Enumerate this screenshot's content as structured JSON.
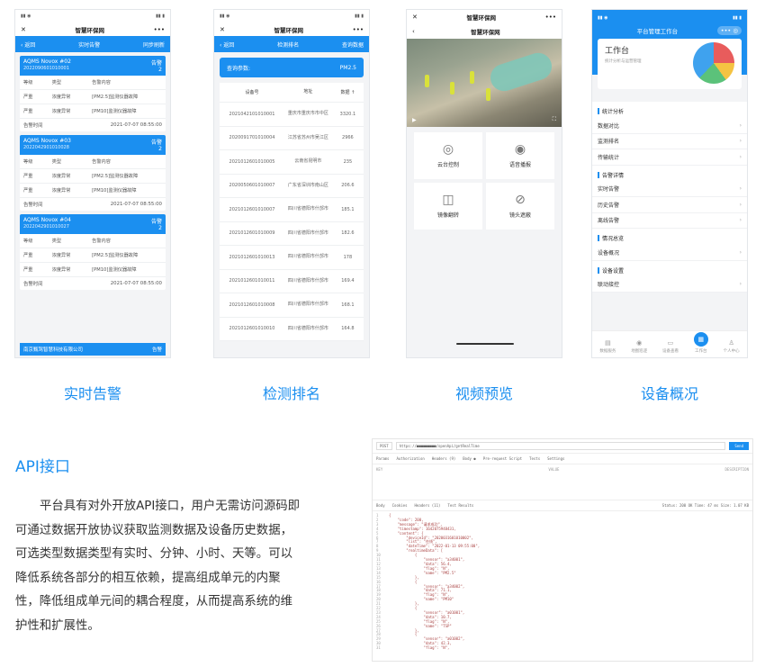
{
  "screens": {
    "alarm": {
      "window_title": "智慧环保网",
      "back": "‹ 返回",
      "title": "实时告警",
      "sync": "同步刷新",
      "cards": [
        {
          "device": "AQMS Novox #02",
          "code": "2022090601010001",
          "tag": "告警",
          "count": "2",
          "rows": [
            [
              "等级",
              "类型",
              "告警内容"
            ],
            [
              "严重",
              "浓度异常",
              "[PM2.5]监测仪器故障"
            ],
            [
              "严重",
              "浓度异常",
              "[PM10]监测仪器故障"
            ]
          ],
          "time_label": "告警时间",
          "time": "2021-07-07 08:55:00"
        },
        {
          "device": "AQMS Novox #03",
          "code": "2022042901010028",
          "tag": "告警",
          "count": "2",
          "rows": [
            [
              "等级",
              "类型",
              "告警内容"
            ],
            [
              "严重",
              "浓度异常",
              "[PM2.5]监测仪器故障"
            ],
            [
              "严重",
              "浓度异常",
              "[PM10]监测仪器故障"
            ]
          ],
          "time_label": "告警时间",
          "time": "2021-07-07 08:55:00"
        },
        {
          "device": "AQMS Novox #04",
          "code": "2022042901010027",
          "tag": "告警",
          "count": "2",
          "rows": [
            [
              "等级",
              "类型",
              "告警内容"
            ],
            [
              "严重",
              "浓度异常",
              "[PM2.5]监测仪器故障"
            ],
            [
              "严重",
              "浓度异常",
              "[PM10]监测仪器故障"
            ]
          ],
          "time_label": "告警时间",
          "time": "2021-07-07 08:55:00"
        }
      ],
      "footer": "南京甄驾智慧科技有限公司",
      "footer_tag": "告警"
    },
    "ranking": {
      "window_title": "智慧环保网",
      "back": "‹ 返回",
      "title": "检测排名",
      "query": "查询数据",
      "param_label": "查询参数:",
      "param_value": "PM2.5",
      "headers": [
        "设备号",
        "地址",
        "数据 ↑"
      ],
      "rows": [
        [
          "2021042101010001",
          "重庆市重庆市市中区",
          "3320.1"
        ],
        [
          "2020091701010004",
          "江苏省苏州市吴江区",
          "2966"
        ],
        [
          "2021012601010005",
          "云南省昆明市",
          "235"
        ],
        [
          "2020050601010007",
          "广东省深圳市南山区",
          "206.6"
        ],
        [
          "2021012601010007",
          "四川省德阳市什邡市",
          "185.1"
        ],
        [
          "2021012601010009",
          "四川省德阳市什邡市",
          "182.6"
        ],
        [
          "2021012601010013",
          "四川省德阳市什邡市",
          "178"
        ],
        [
          "2021012601010011",
          "四川省德阳市什邡市",
          "169.4"
        ],
        [
          "2021012601010008",
          "四川省德阳市什邡市",
          "168.1"
        ],
        [
          "2021012601010010",
          "四川省德阳市什邡市",
          "164.8"
        ]
      ]
    },
    "video": {
      "window_title": "智慧环保网",
      "sub_title": "智慧环保网",
      "controls": [
        "云台控制",
        "语音播报",
        "镜像翻转",
        "镜头遮蔽"
      ],
      "control_icons": [
        "ptz-icon",
        "speaker-icon",
        "mirror-icon",
        "eye-hidden-icon"
      ]
    },
    "overview": {
      "title": "平台管理工作台",
      "card_title": "工作台",
      "card_sub": "统计分析与运营管理",
      "sections": [
        {
          "title": "统计分析",
          "items": [
            "数据对比",
            "监测排名",
            "传输统计"
          ]
        },
        {
          "title": "告警详情",
          "items": [
            "实时告警",
            "历史告警",
            "离线告警"
          ]
        },
        {
          "title": "情况总览",
          "items": [
            "设备概况"
          ]
        },
        {
          "title": "设备设置",
          "items": [
            "联动接控"
          ]
        }
      ],
      "tabs": [
        "数据服务",
        "地图巡逻",
        "设备查看",
        "工作台",
        "个人中心"
      ]
    }
  },
  "captions": [
    "实时告警",
    "检测排名",
    "视频预览",
    "设备概况"
  ],
  "api": {
    "title": "API接口",
    "paragraph": "平台具有对外开放API接口，用户无需访问源码即可通过数据开放协议获取监测数据及设备历史数据，可选类型数据类型有实时、分钟、小时、天等。可以降低系统各部分的相互依赖，提高组成单元的内聚性，降低组成单元间的耦合程度，从而提高系统的维护性和扩展性。",
    "method": "POST",
    "url": "https://■■■■■■■■■/openApi/getRealTime",
    "send": "Send",
    "tabs": [
      "Params",
      "Authorization",
      "Headers (9)",
      "Body ●",
      "Pre-request Script",
      "Tests",
      "Settings"
    ],
    "resp_tabs": [
      "Body",
      "Cookies",
      "Headers (11)",
      "Test Results"
    ],
    "status": "Status: 200 OK   Time: 47 ms   Size: 1.07 KB",
    "json_lines": [
      "{",
      "    \"code\": 200,",
      "    \"message\": \"请求成功\",",
      "    \"timestamp\": 1642075948431,",
      "    \"content\": {",
      "        \"deviceId\": \"2020031601010002\",",
      "        \"list\": \"在线\",",
      "        \"dateTime\": \"2022-01-13 09:55:00\",",
      "        \"realtimeData\": [",
      "            {",
      "                \"sensor\": \"a34001\",",
      "                \"data\": 56.4,",
      "                \"flag\": \"N\",",
      "                \"name\": \"PM2.5\"",
      "            },",
      "            {",
      "                \"sensor\": \"a34002\",",
      "                \"data\": 71.1,",
      "                \"flag\": \"N\",",
      "                \"name\": \"PM10\"",
      "            },",
      "            {",
      "                \"sensor\": \"a01001\",",
      "                \"data\": 10.7,",
      "                \"flag\": \"N\",",
      "                \"name\": \"TSP\"",
      "            },",
      "            {",
      "                \"sensor\": \"a01002\",",
      "                \"data\": 42.3,",
      "                \"flag\": \"N\","
    ]
  },
  "colors": {
    "accent": "#1b8ff0"
  }
}
